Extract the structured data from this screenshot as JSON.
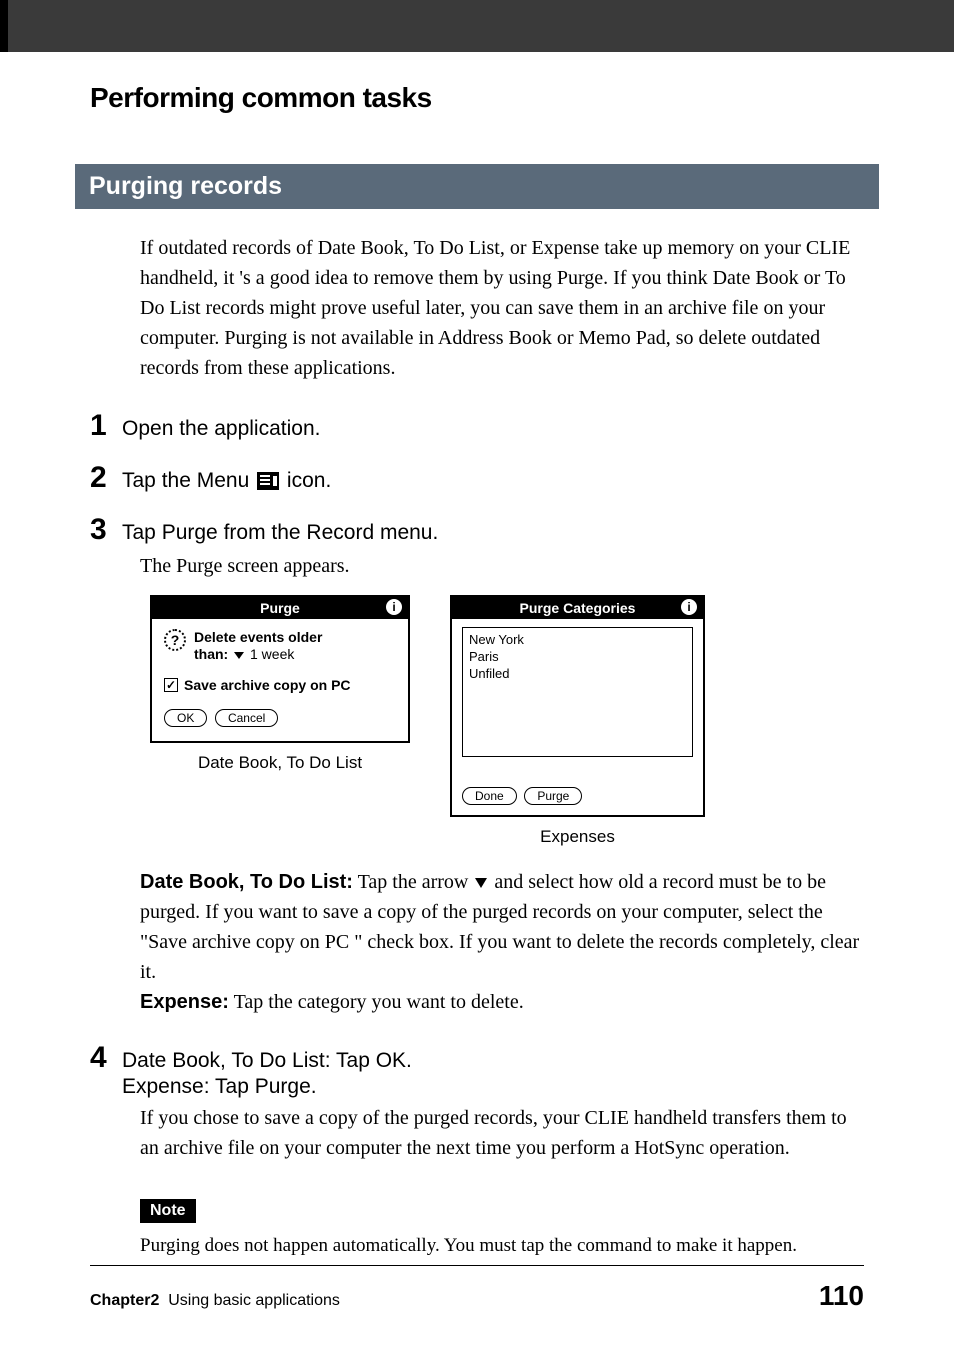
{
  "title": "Performing common tasks",
  "section_heading": "Purging records",
  "intro": "If outdated records of Date Book, To Do List, or Expense take up memory on your CLIE handheld, it 's a good idea to remove them by using Purge. If you think Date Book or To Do List records might prove useful later, you can save them in an archive file on your computer. Purging is not available in Address Book or Memo Pad, so delete outdated records from these applications.",
  "steps": {
    "s1": {
      "num": "1",
      "text": "Open the application."
    },
    "s2": {
      "num": "2",
      "text_before": "Tap the Menu ",
      "text_after": " icon."
    },
    "s3": {
      "num": "3",
      "text": "Tap Purge from the Record menu.",
      "sub": "The Purge screen appears."
    },
    "s4": {
      "num": "4",
      "text_a": "Date Book, To Do List: Tap OK.",
      "text_b": "Expense: Tap Purge.",
      "sub": "If you chose to save a copy of the purged records, your CLIE handheld transfers them to an archive file on your computer the next time you perform a HotSync operation."
    }
  },
  "screens": {
    "purge": {
      "title": "Purge",
      "delete_label": "Delete events older than:",
      "duration": "1 week",
      "checkbox_label": "Save archive copy on PC",
      "ok": "OK",
      "cancel": "Cancel",
      "caption": "Date Book, To Do List"
    },
    "categories": {
      "title": "Purge Categories",
      "items": [
        "New York",
        "Paris",
        "Unfiled"
      ],
      "done": "Done",
      "purge": "Purge",
      "caption": "Expenses"
    }
  },
  "explain": {
    "db_label": "Date Book, To Do List:",
    "db_text": " Tap the arrow ",
    "db_text2": " and select how old a record must be to be purged. If you want to save a copy of the purged records on your computer, select the \"Save archive copy on PC \" check box. If you want to delete the records completely, clear it.",
    "exp_label": "Expense:",
    "exp_text": " Tap the category you want to delete."
  },
  "note": {
    "label": "Note",
    "text": "Purging does not happen automatically. You must tap the command to make it happen."
  },
  "footer": {
    "chapter": "Chapter2",
    "title": "Using basic applications",
    "page": "110"
  }
}
